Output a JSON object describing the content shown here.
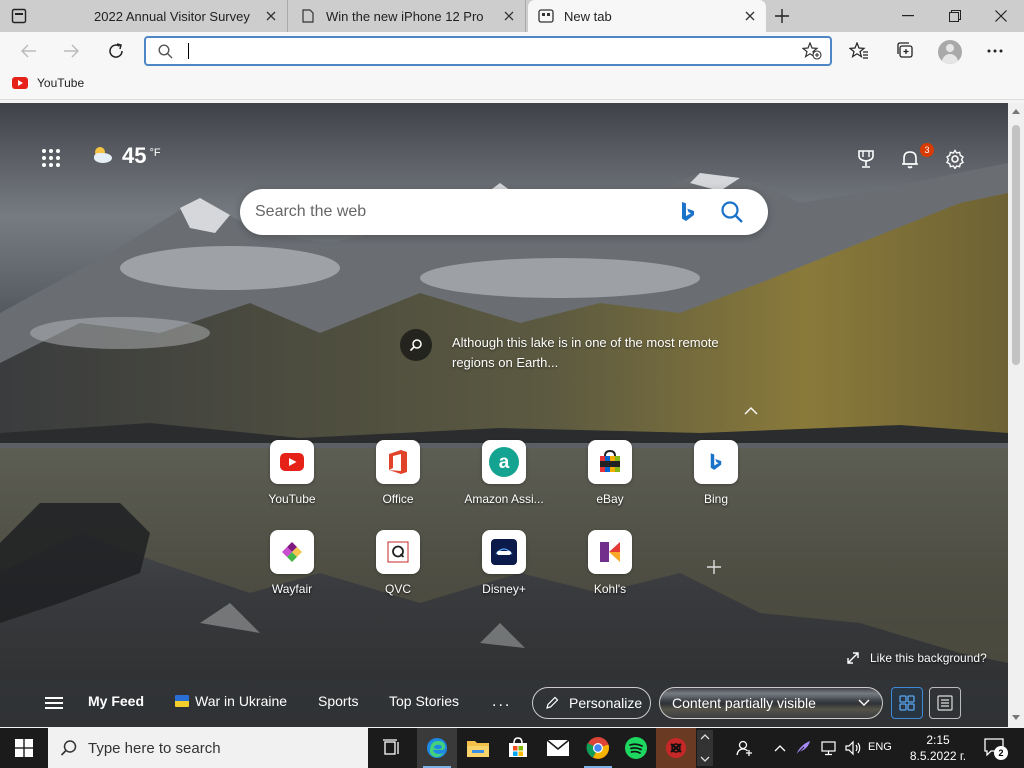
{
  "browser": {
    "tabs": [
      {
        "title": "2022 Annual Visitor Survey",
        "icon": "doc-icon",
        "active": false
      },
      {
        "title": "Win the new iPhone 12 Pro",
        "icon": "page-icon",
        "active": false
      },
      {
        "title": "New tab",
        "icon": "newtab-icon",
        "active": true
      }
    ],
    "address_bar": {
      "value": "",
      "placeholder": ""
    },
    "favorites": [
      {
        "label": "YouTube",
        "icon": "youtube-icon"
      }
    ]
  },
  "newtab": {
    "weather": {
      "temp": "45",
      "unit": "°F",
      "icon": "partly-cloudy-icon"
    },
    "notification_count": "3",
    "search": {
      "placeholder": "Search the web"
    },
    "image_info": {
      "text": "Although this lake is in one of the most remote regions on Earth..."
    },
    "quick_links": [
      {
        "label": "YouTube",
        "icon": "youtube-icon"
      },
      {
        "label": "Office",
        "icon": "office-icon"
      },
      {
        "label": "Amazon Assi...",
        "icon": "amazon-icon"
      },
      {
        "label": "eBay",
        "icon": "ebay-icon"
      },
      {
        "label": "Bing",
        "icon": "bing-icon"
      },
      {
        "label": "Wayfair",
        "icon": "wayfair-icon"
      },
      {
        "label": "QVC",
        "icon": "qvc-icon"
      },
      {
        "label": "Disney+",
        "icon": "disney-icon"
      },
      {
        "label": "Kohl's",
        "icon": "kohls-icon"
      }
    ],
    "like_background": "Like this background?",
    "feed_nav": {
      "items": [
        "My Feed",
        "War in Ukraine",
        "Sports",
        "Top Stories"
      ],
      "more": "...",
      "personalize": "Personalize",
      "content_visibility": "Content partially visible"
    }
  },
  "taskbar": {
    "search_placeholder": "Type here to search",
    "language": "ENG",
    "time": "2:15",
    "date": "8.5.2022 г.",
    "notification_count": "2"
  },
  "colors": {
    "accent": "#4f86c6",
    "youtube": "#e62117",
    "badge": "#d83b01"
  }
}
